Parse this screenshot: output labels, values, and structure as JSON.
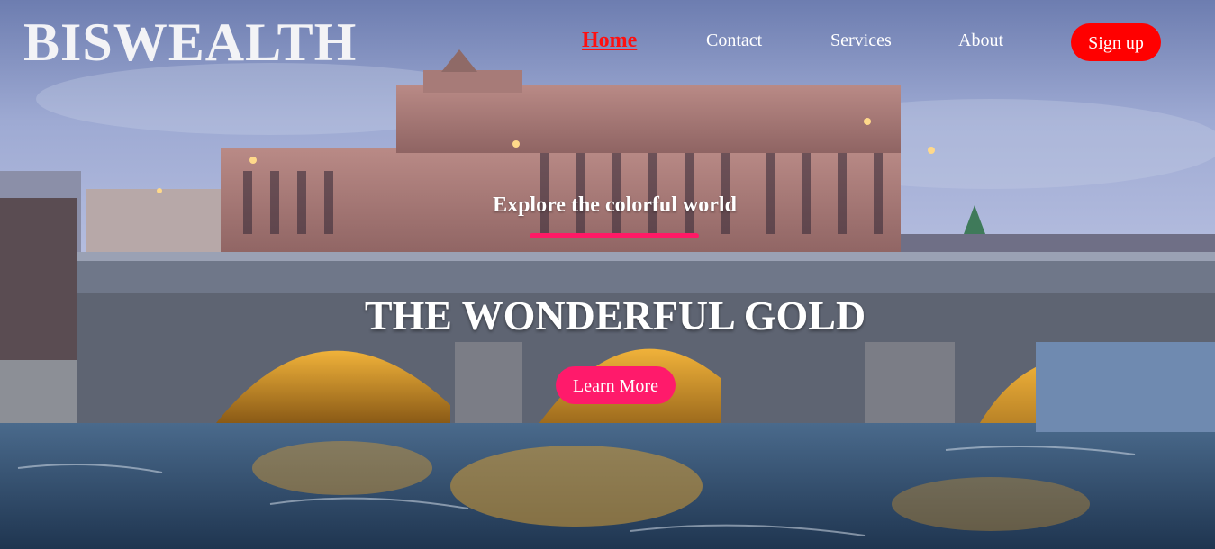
{
  "brand": {
    "name": "BISWEALTH"
  },
  "nav": {
    "items": [
      {
        "label": "Home",
        "active": true
      },
      {
        "label": "Contact",
        "active": false
      },
      {
        "label": "Services",
        "active": false
      },
      {
        "label": "About",
        "active": false
      }
    ],
    "signup_label": "Sign up"
  },
  "hero": {
    "tagline": "Explore the colorful world",
    "headline": "THE WONDERFUL GOLD",
    "cta_label": "Learn More",
    "background_icon": "city-bridge-photo"
  },
  "colors": {
    "active_nav": "#ff1010",
    "signup_bg": "#ff0000",
    "accent_pink": "#ff1a6b",
    "text_light": "#ffffff"
  }
}
